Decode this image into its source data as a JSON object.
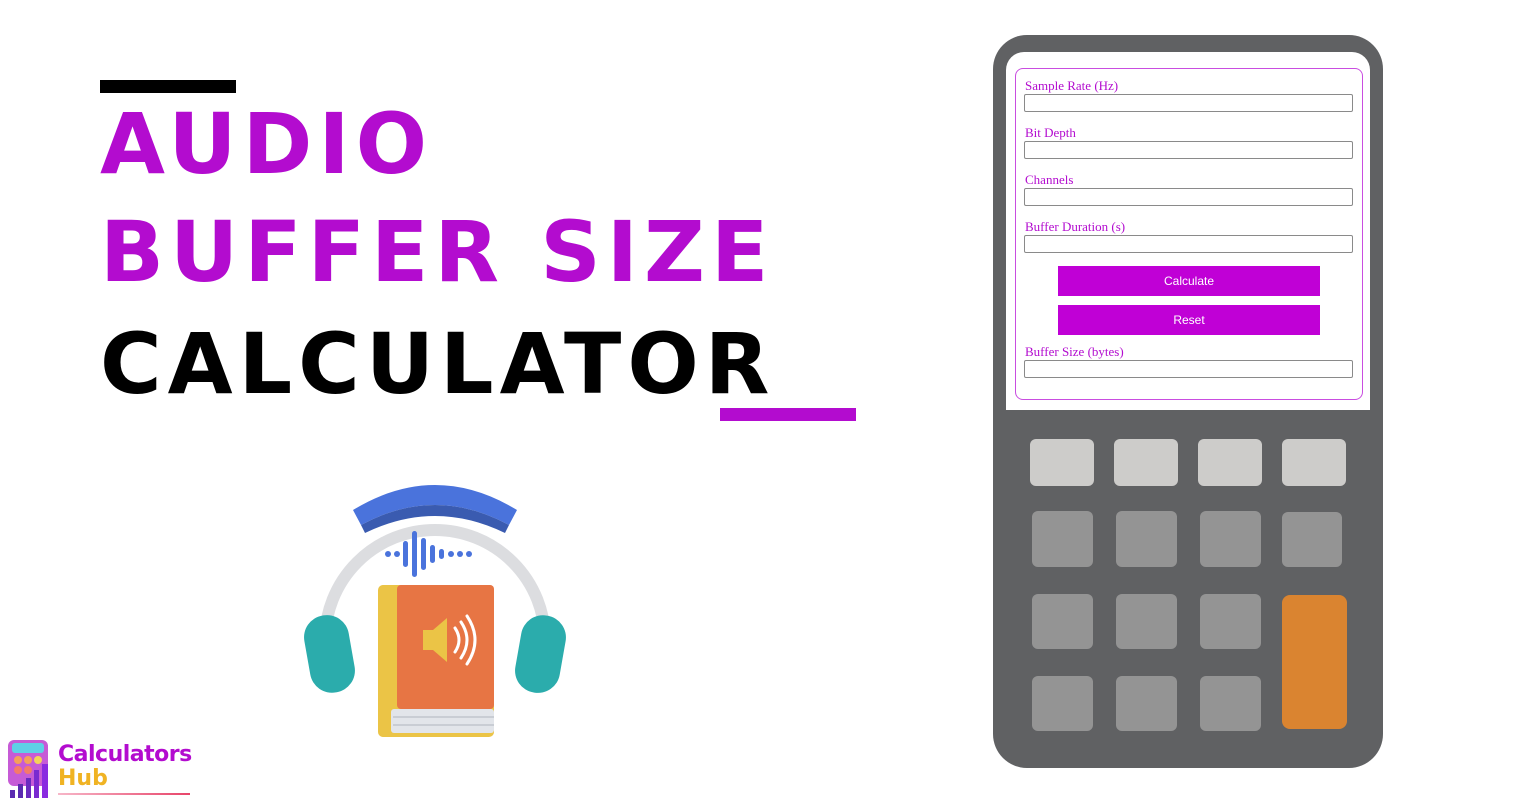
{
  "title": {
    "line1": "AUDIO",
    "line2": "BUFFER SIZE",
    "line3": "CALCULATOR"
  },
  "colors": {
    "accent": "#b30ccf",
    "button": "#c000d6",
    "calculator_body": "#606163",
    "key_light": "#cdccca",
    "key_mid": "#949494",
    "key_orange": "#da8430"
  },
  "illustration": {
    "icon": "audiobook-headphones-icon"
  },
  "form": {
    "fields": [
      {
        "label": "Sample Rate (Hz)",
        "value": "",
        "placeholder": ""
      },
      {
        "label": "Bit Depth",
        "value": "",
        "placeholder": ""
      },
      {
        "label": "Channels",
        "value": "",
        "placeholder": ""
      },
      {
        "label": "Buffer Duration (s)",
        "value": "",
        "placeholder": ""
      }
    ],
    "calculate_label": "Calculate",
    "reset_label": "Reset",
    "result": {
      "label": "Buffer Size (bytes)",
      "value": ""
    }
  },
  "logo": {
    "line1": "Calculators",
    "line2": "Hub"
  }
}
